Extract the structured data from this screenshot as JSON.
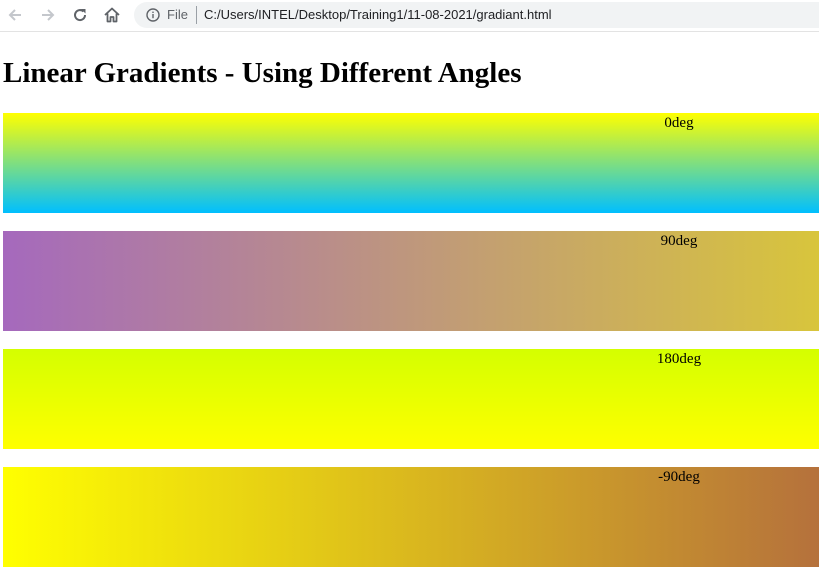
{
  "browser": {
    "url_scheme": "File",
    "url": "C:/Users/INTEL/Desktop/Training1/11-08-2021/gradiant.html",
    "icons": [
      "back-arrow-icon",
      "forward-arrow-icon",
      "reload-icon",
      "home-icon",
      "info-icon"
    ]
  },
  "page": {
    "heading": "Linear Gradients - Using Different Angles",
    "gradients": [
      {
        "label": "0deg",
        "angle": "0deg",
        "colors": [
          "#00bfff",
          "#ffff00"
        ]
      },
      {
        "label": "90deg",
        "angle": "90deg",
        "colors": [
          "#a569bd",
          "#d8c53c"
        ]
      },
      {
        "label": "180deg",
        "angle": "180deg",
        "colors": [
          "#d4ff00",
          "#ffff00"
        ]
      },
      {
        "label": "-90deg",
        "angle": "-90deg",
        "colors": [
          "#b5713c",
          "#ffff00"
        ]
      }
    ]
  }
}
